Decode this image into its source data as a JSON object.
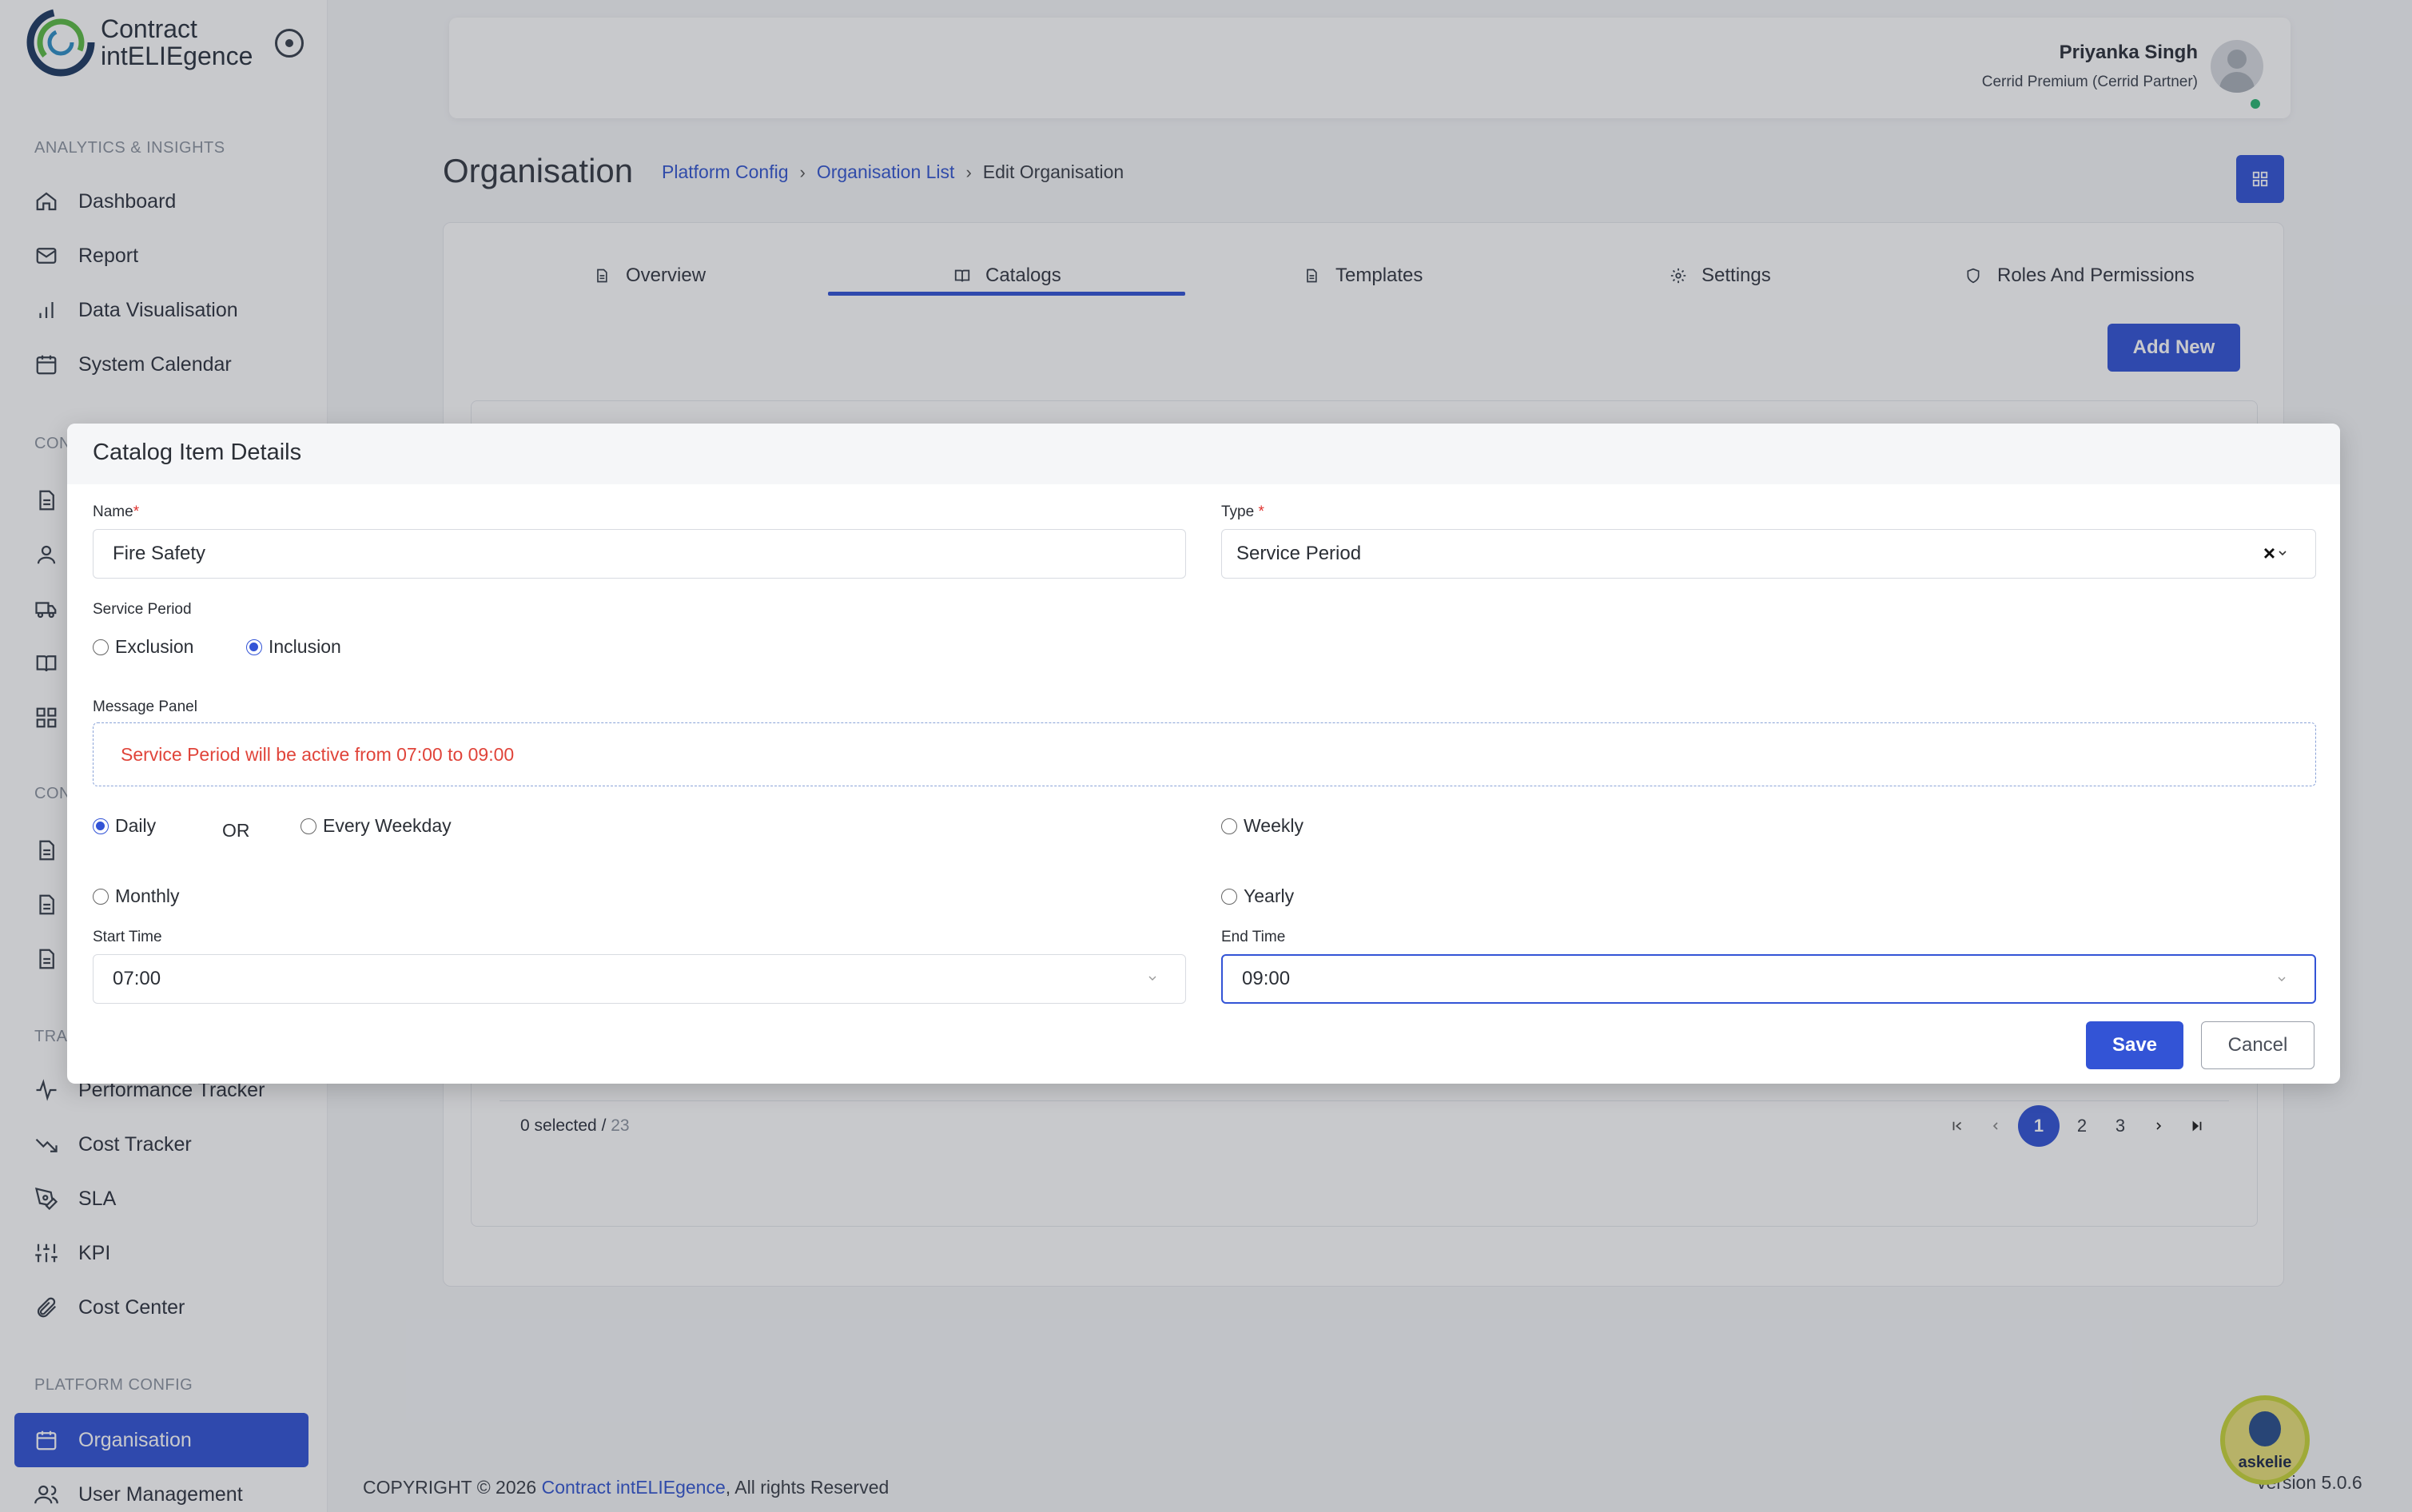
{
  "app": {
    "logo_line1": "Contract",
    "logo_line2": "intELIEgence"
  },
  "sidebar": {
    "sections": {
      "analytics": "ANALYTICS & INSIGHTS",
      "con1": "CON",
      "con2": "CON",
      "tra": "TRA",
      "platform": "PLATFORM CONFIG"
    },
    "items": {
      "dashboard": "Dashboard",
      "report": "Report",
      "data_visualisation": "Data Visualisation",
      "system_calendar": "System Calendar",
      "performance_tracker": "Performance Tracker",
      "cost_tracker": "Cost Tracker",
      "sla": "SLA",
      "kpi": "KPI",
      "cost_center": "Cost Center",
      "organisation": "Organisation",
      "user_management": "User Management"
    }
  },
  "header": {
    "user_name": "Priyanka Singh",
    "user_role": "Cerrid Premium (Cerrid Partner)"
  },
  "page": {
    "title": "Organisation",
    "breadcrumb": {
      "b1": "Platform Config",
      "b2": "Organisation List",
      "b3": "Edit Organisation"
    }
  },
  "tabs": {
    "overview": "Overview",
    "catalogs": "Catalogs",
    "templates": "Templates",
    "settings": "Settings",
    "roles": "Roles And Permissions"
  },
  "catalogs": {
    "add_new": "Add New",
    "selected": "0 selected /",
    "total": "23",
    "pages": [
      "1",
      "2",
      "3"
    ],
    "current_page": 1
  },
  "modal": {
    "title": "Catalog Item Details",
    "name_label": "Name",
    "name_value": "Fire Safety",
    "type_label": "Type",
    "type_value": "Service Period",
    "service_period_label": "Service Period",
    "exclusion": "Exclusion",
    "inclusion": "Inclusion",
    "message_panel_label": "Message Panel",
    "message": "Service Period will be active from 07:00 to 09:00",
    "daily": "Daily",
    "or": "OR",
    "every_weekday": "Every Weekday",
    "weekly": "Weekly",
    "monthly": "Monthly",
    "yearly": "Yearly",
    "start_time_label": "Start Time",
    "start_time": "07:00",
    "end_time_label": "End Time",
    "end_time": "09:00",
    "save": "Save",
    "cancel": "Cancel"
  },
  "footer": {
    "copyright": "COPYRIGHT © 2026",
    "brand": "Contract intELIEgence",
    "rights": ", All rights Reserved",
    "version": "version 5.0.6",
    "assistant": "askelie"
  },
  "colors": {
    "primary": "#3354d6",
    "error": "#e0443a"
  }
}
